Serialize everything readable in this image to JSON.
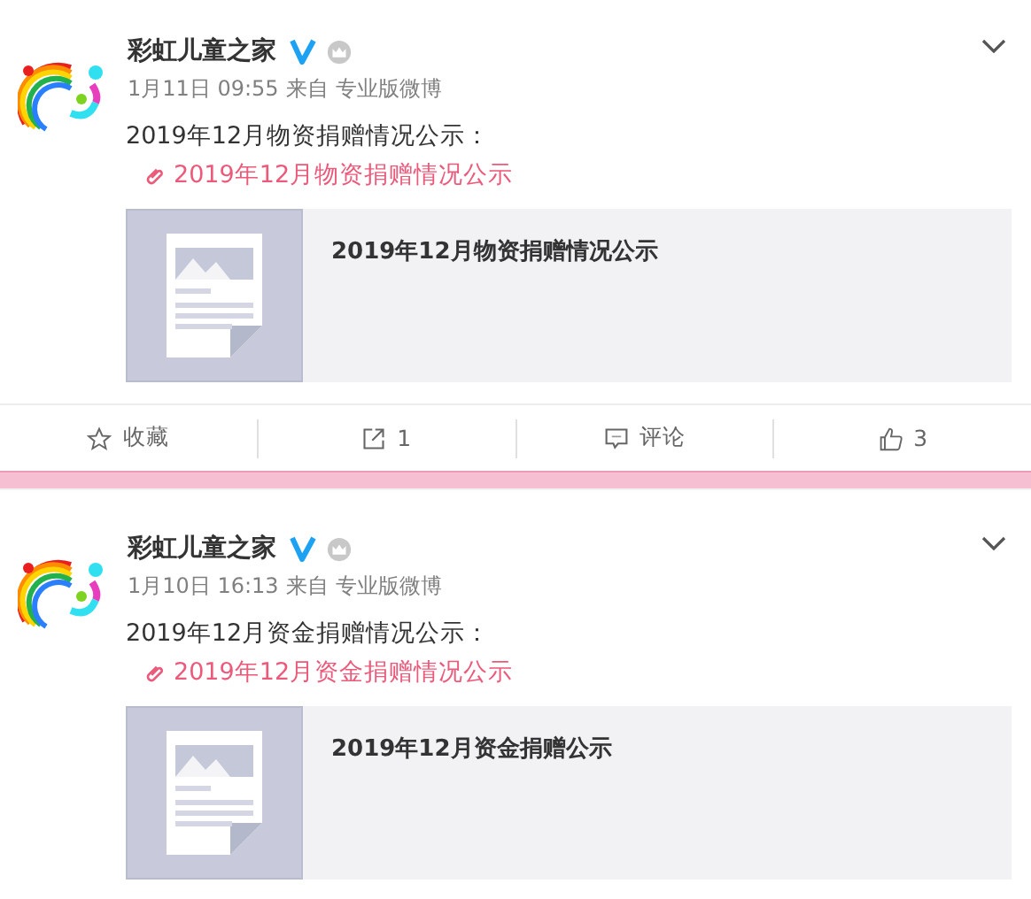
{
  "posts": [
    {
      "author": "彩虹儿童之家",
      "verified": true,
      "time": "1月11日 09:55",
      "source_prefix": "来自",
      "source": "专业版微博",
      "text": "2019年12月物资捐赠情况公示：",
      "link": "2019年12月物资捐赠情况公示",
      "card_title": "2019年12月物资捐赠情况公示",
      "actions": [
        {
          "kind": "favorite",
          "label": "收藏"
        },
        {
          "kind": "share",
          "label": "1"
        },
        {
          "kind": "comment",
          "label": "评论"
        },
        {
          "kind": "like",
          "label": "3"
        }
      ]
    },
    {
      "author": "彩虹儿童之家",
      "verified": true,
      "time": "1月10日 16:13",
      "source_prefix": "来自",
      "source": "专业版微博",
      "text": "2019年12月资金捐赠情况公示：",
      "link": "2019年12月资金捐赠情况公示",
      "card_title": "2019年12月资金捐赠公示"
    }
  ]
}
